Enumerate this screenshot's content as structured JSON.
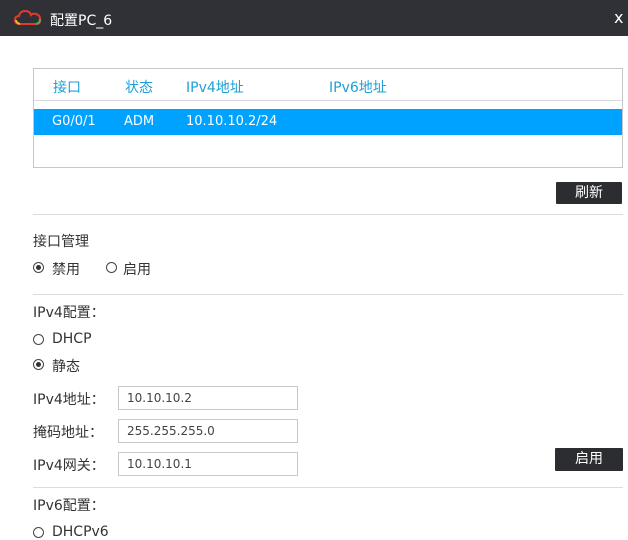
{
  "window": {
    "title": "配置PC_6",
    "close_glyph": "x"
  },
  "interfaces": {
    "headers": {
      "port": "接口",
      "status": "状态",
      "ipv4": "IPv4地址",
      "ipv6": "IPv6地址"
    },
    "rows": [
      {
        "port": "G0/0/1",
        "status": "ADM",
        "ipv4": "10.10.10.2/24",
        "ipv6": ""
      }
    ],
    "selected_row_color": "#00a2ff",
    "header_color": "#1f9fd5"
  },
  "refresh_button": "刷新",
  "iface_mgmt": {
    "title": "接口管理",
    "options": [
      {
        "label": "禁用",
        "checked": true
      },
      {
        "label": "启用",
        "checked": false
      }
    ]
  },
  "ipv4": {
    "title": "IPv4配置：",
    "options": [
      {
        "label": "DHCP",
        "checked": false
      },
      {
        "label": "静态",
        "checked": true
      }
    ],
    "fields": {
      "address_label": "IPv4地址：",
      "address_value": "10.10.10.2",
      "mask_label": "掩码地址：",
      "mask_value": "255.255.255.0",
      "gateway_label": "IPv4网关：",
      "gateway_value": "10.10.10.1"
    },
    "apply_button": "启用"
  },
  "ipv6": {
    "title": "IPv6配置：",
    "options": [
      {
        "label": "DHCPv6",
        "checked": false
      }
    ]
  },
  "colors": {
    "titlebar": "#2f3136",
    "button": "#2b2d31"
  }
}
